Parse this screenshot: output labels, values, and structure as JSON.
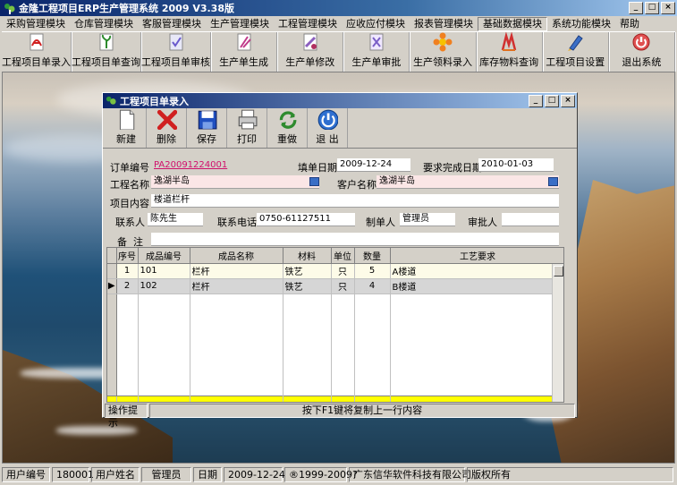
{
  "app": {
    "title": "金隆工程项目ERP生产管理系统 2009 V3.38版",
    "minimize": "_",
    "maximize": "□",
    "close": "×"
  },
  "menu": [
    "采购管理模块",
    "仓库管理模块",
    "客服管理模块",
    "生产管理模块",
    "工程管理模块",
    "应收应付模块",
    "报表管理模块",
    "基础数据模块",
    "系统功能模块",
    "帮助"
  ],
  "menu_active_index": 7,
  "toolbar": [
    {
      "label": "工程项目单录入",
      "icon": "pdf-document-icon"
    },
    {
      "label": "工程项目单查询",
      "icon": "plant-document-icon"
    },
    {
      "label": "工程项目单审核",
      "icon": "check-document-icon"
    },
    {
      "label": "生产单生成",
      "icon": "generate-document-icon"
    },
    {
      "label": "生产单修改",
      "icon": "edit-document-icon"
    },
    {
      "label": "生产单审批",
      "icon": "approve-document-icon"
    },
    {
      "label": "生产领料录入",
      "icon": "flower-icon"
    },
    {
      "label": "库存物料查询",
      "icon": "stock-query-icon"
    },
    {
      "label": "工程项目设置",
      "icon": "pen-settings-icon"
    },
    {
      "label": "退出系统",
      "icon": "exit-icon"
    }
  ],
  "child": {
    "title": "工程项目单录入",
    "tools": [
      {
        "label": "新建",
        "icon": "new-page-icon"
      },
      {
        "label": "删除",
        "icon": "delete-x-icon"
      },
      {
        "label": "保存",
        "icon": "save-disk-icon"
      },
      {
        "label": "打印",
        "icon": "printer-icon"
      },
      {
        "label": "重做",
        "icon": "redo-arrows-icon"
      },
      {
        "label": "退 出",
        "icon": "power-exit-icon"
      }
    ],
    "form": {
      "order_no_label": "订单编号",
      "order_no": "PA20091224001",
      "fill_date_label": "填单日期",
      "fill_date": "2009-12-24",
      "due_date_label": "要求完成日期",
      "due_date": "2010-01-03",
      "project_name_label": "工程名称",
      "project_name": "逸湖半岛",
      "customer_label": "客户名称",
      "customer": "逸湖半岛",
      "content_label": "项目内容",
      "content": "楼道栏杆",
      "contact_label": "联系人",
      "contact": "陈先生",
      "phone_label": "联系电话",
      "phone": "0750-61127511",
      "maker_label": "制单人",
      "maker": "管理员",
      "approver_label": "审批人",
      "approver": "",
      "remark_label": "备  注",
      "remark": ""
    },
    "grid": {
      "headers": [
        "序号",
        "成品编号",
        "成品名称",
        "材料",
        "单位",
        "数量",
        "工艺要求"
      ],
      "rows": [
        [
          "1",
          "101",
          "栏杆",
          "铁艺",
          "只",
          "5",
          "A楼道"
        ],
        [
          "2",
          "102",
          "栏杆",
          "铁艺",
          "只",
          "4",
          "B楼道"
        ]
      ],
      "current_row": 2
    },
    "hint_label": "操作提示",
    "hint_text": "按下F1键将复制上一行内容"
  },
  "status": {
    "user_no_label": "用户编号",
    "user_no": "180001",
    "user_name_label": "用户姓名",
    "user_name": "管理员",
    "date_label": "日期",
    "date": "2009-12-24",
    "copyright": "®1999-2009?",
    "company": "广东信华软件科技有限公司",
    "rights": "版权所有"
  }
}
